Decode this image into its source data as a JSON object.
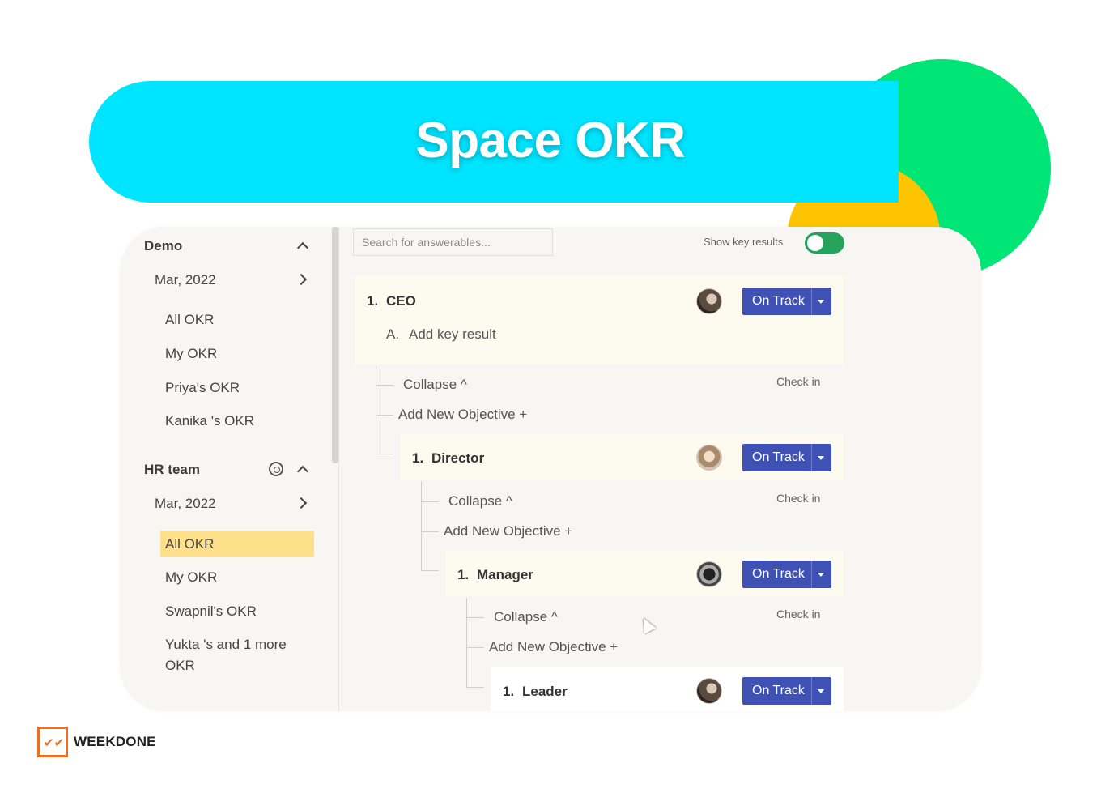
{
  "banner": {
    "title": "Space OKR"
  },
  "brand": {
    "name": "WEEKDONE",
    "accent": "#ef6c22"
  },
  "colors": {
    "banner": "#00e5ff",
    "green_circle": "#00e676",
    "yellow_circle": "#ffc400",
    "status_button": "#3f51b5",
    "active_item": "#ffe08a",
    "toggle_on": "#25a35a"
  },
  "sidebar": {
    "sections": [
      {
        "name": "Demo",
        "month": "Mar, 2022",
        "items": [
          "All OKR",
          "My OKR",
          "Priya's OKR",
          "Kanika 's OKR"
        ]
      },
      {
        "name": "HR team",
        "month": "Mar, 2022",
        "items": [
          "All OKR",
          "My OKR",
          "Swapnil's OKR",
          "Yukta 's and 1 more",
          "OKR"
        ],
        "active_item": "All OKR"
      }
    ]
  },
  "main": {
    "search": {
      "placeholder": "Search for answerables..."
    },
    "toggle": {
      "label": "Show key results",
      "on": true
    },
    "objectives": [
      {
        "number": "1.",
        "title": "CEO",
        "status": "On Track",
        "key_result_prefix": "A.",
        "key_result": "Add key result"
      },
      {
        "number": "1.",
        "title": "Director",
        "status": "On Track"
      },
      {
        "number": "1.",
        "title": "Manager",
        "status": "On Track"
      },
      {
        "number": "1.",
        "title": "Leader",
        "status": "On Track"
      }
    ],
    "controls": {
      "collapse": "Collapse ^",
      "add_objective": "Add New Objective +",
      "check_in": "Check in"
    }
  }
}
